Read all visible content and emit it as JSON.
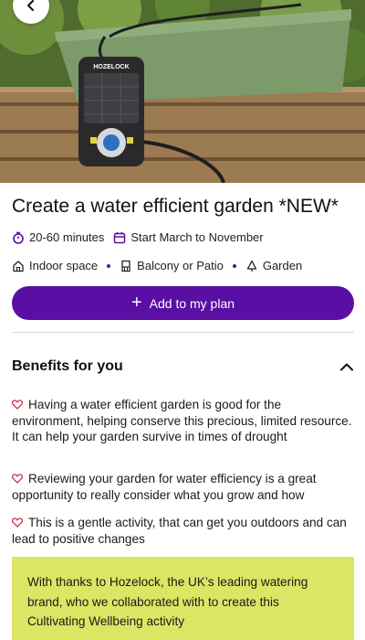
{
  "hero": {
    "image_alt": "Hozelock watering timer on a green planter"
  },
  "hero_logo_text": "HOZELOCK",
  "activity": {
    "title": "Create a water efficient garden *NEW*",
    "duration": "20-60 minutes",
    "season": "Start March to November",
    "locations": [
      "Indoor space",
      "Balcony or Patio",
      "Garden"
    ]
  },
  "actions": {
    "add_label": "Add to my plan"
  },
  "benefits": {
    "heading": "Benefits for you",
    "items": [
      "Having a water efficient garden is good for the environment, helping conserve this precious, limited resource. It can help your garden survive in times of drought",
      "Reviewing your garden for water efficiency is a great opportunity to really consider what you grow and how",
      "This is a gentle activity, that can get you outdoors and can lead to positive changes"
    ]
  },
  "thanks": {
    "text": "With thanks to Hozelock, the UK’s leading watering brand, who we collaborated with to create this Cultivating Wellbeing activity"
  },
  "colors": {
    "brand_purple": "#5b0ea3",
    "heart_red": "#d0304a",
    "thanks_bg": "#dde565"
  }
}
